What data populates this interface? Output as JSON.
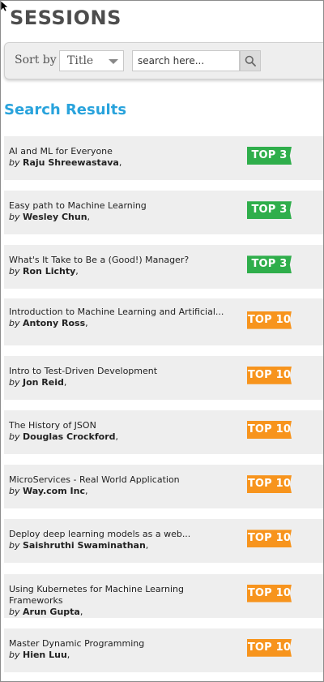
{
  "header": {
    "title": "SESSIONS"
  },
  "toolbar": {
    "sort_label": "Sort by :",
    "sort_value": "Title",
    "search_placeholder": "search here..."
  },
  "results": {
    "heading": "Search Results"
  },
  "colors": {
    "heading_blue": "#29a3dc",
    "badge_green": "#2fae4b",
    "badge_orange": "#f7941d",
    "row_background": "#eeeeee"
  },
  "icons": {
    "search": "magnifier-icon",
    "sort_dropdown": "chevron-down-icon",
    "cursor": "arrow-cursor-icon"
  },
  "sessions": [
    {
      "title": "AI and ML for Everyone",
      "by": "by",
      "speaker": "Raju Shreewastava",
      "suffix": ",",
      "badge": "TOP 3",
      "badge_color": "#2fae4b"
    },
    {
      "title": "Easy path to Machine Learning",
      "by": "by",
      "speaker": "Wesley Chun",
      "suffix": ",",
      "badge": "TOP 3",
      "badge_color": "#2fae4b"
    },
    {
      "title": "What's It Take to Be a (Good!) Manager?",
      "by": "by",
      "speaker": "Ron Lichty",
      "suffix": ",",
      "badge": "TOP 3",
      "badge_color": "#2fae4b"
    },
    {
      "title": "Introduction to Machine Learning and Artificial...",
      "by": "by",
      "speaker": "Antony Ross",
      "suffix": ",",
      "badge": "TOP 10",
      "badge_color": "#f7941d"
    },
    {
      "title": "Intro to Test-Driven Development",
      "by": "by",
      "speaker": "Jon Reid",
      "suffix": ",",
      "badge": "TOP 10",
      "badge_color": "#f7941d"
    },
    {
      "title": "The History of JSON",
      "by": "by",
      "speaker": "Douglas Crockford",
      "suffix": ",",
      "badge": "TOP 10",
      "badge_color": "#f7941d"
    },
    {
      "title": "MicroServices - Real World Application",
      "by": "by",
      "speaker": "Way.com Inc",
      "suffix": ",",
      "badge": "TOP 10",
      "badge_color": "#f7941d"
    },
    {
      "title": "Deploy deep learning models as a web...",
      "by": "by",
      "speaker": "Saishruthi Swaminathan",
      "suffix": ",",
      "badge": "TOP 10",
      "badge_color": "#f7941d"
    },
    {
      "title": "Using Kubernetes for Machine Learning Frameworks",
      "by": "by",
      "speaker": "Arun Gupta",
      "suffix": ",",
      "badge": "TOP 10",
      "badge_color": "#f7941d"
    },
    {
      "title": "Master Dynamic Programming",
      "by": "by",
      "speaker": "Hien Luu",
      "suffix": ",",
      "badge": "TOP 10",
      "badge_color": "#f7941d"
    }
  ]
}
